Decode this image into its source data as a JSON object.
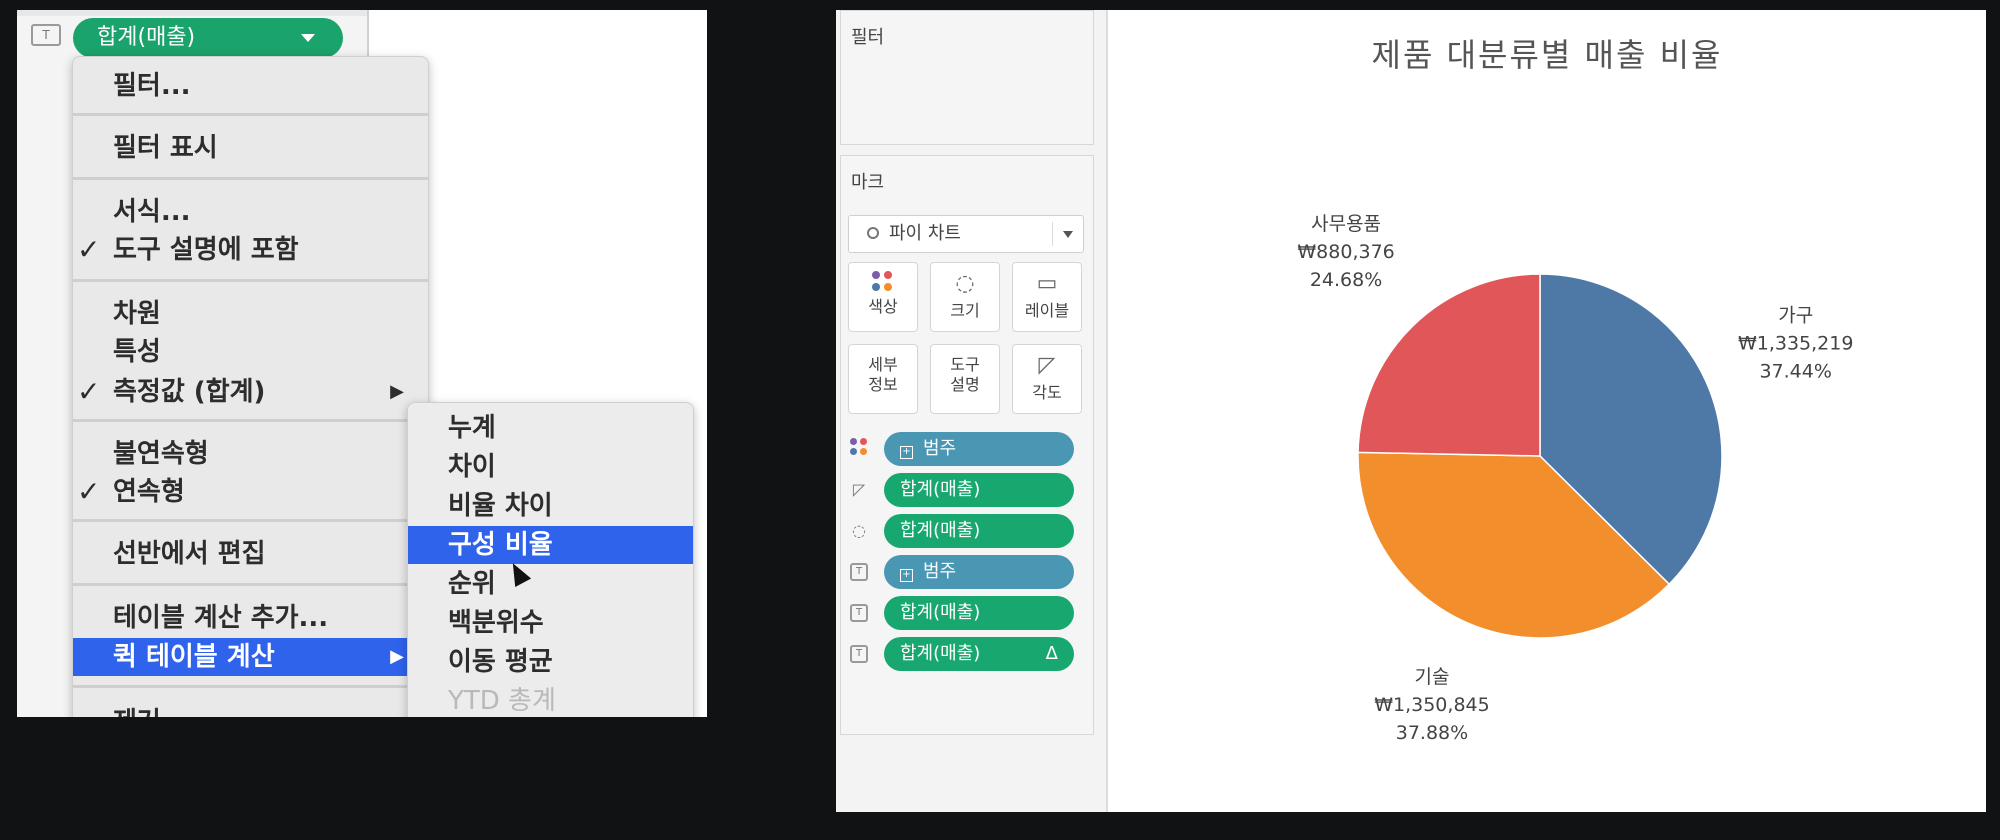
{
  "left": {
    "shelf_pill": "합계(매출)",
    "menu": {
      "items": [
        {
          "label": "필터...",
          "checked": false,
          "submenu": false
        },
        {
          "label": "필터 표시",
          "checked": false,
          "submenu": false
        },
        {
          "label": "서식...",
          "checked": false,
          "submenu": false
        },
        {
          "label": "도구 설명에 포함",
          "checked": true,
          "submenu": false
        },
        {
          "label": "차원",
          "checked": false,
          "submenu": false
        },
        {
          "label": "특성",
          "checked": false,
          "submenu": false
        },
        {
          "label": "측정값 (합계)",
          "checked": true,
          "submenu": true
        },
        {
          "label": "불연속형",
          "checked": false,
          "submenu": false
        },
        {
          "label": "연속형",
          "checked": true,
          "submenu": false
        },
        {
          "label": "선반에서 편집",
          "checked": false,
          "submenu": false
        },
        {
          "label": "테이블 계산 추가...",
          "checked": false,
          "submenu": false
        },
        {
          "label": "퀵 테이블 계산",
          "checked": false,
          "submenu": true,
          "highlighted": true
        },
        {
          "label": "제거",
          "checked": false,
          "submenu": false
        }
      ],
      "check_glyph": "✓",
      "arrow_glyph": "▶"
    },
    "submenu": {
      "items": [
        {
          "label": "누계"
        },
        {
          "label": "차이"
        },
        {
          "label": "비율 차이"
        },
        {
          "label": "구성 비율",
          "highlighted": true
        },
        {
          "label": "순위"
        },
        {
          "label": "백분위수"
        },
        {
          "label": "이동 평균"
        },
        {
          "label": "YTD 총계",
          "disabled": true
        }
      ]
    }
  },
  "right": {
    "filters_title": "필터",
    "marks_title": "마크",
    "mark_type": "파이 차트",
    "mark_buttons": [
      {
        "label": "색상",
        "icon": "color-dots-icon"
      },
      {
        "label": "크기",
        "icon": "size-icon"
      },
      {
        "label": "레이블",
        "icon": "label-icon"
      },
      {
        "label": "세부\n정보",
        "icon": "none"
      },
      {
        "label": "도구\n설명",
        "icon": "none"
      },
      {
        "label": "각도",
        "icon": "angle-icon"
      }
    ],
    "mark_pills": [
      {
        "icon": "color-dots-icon",
        "label": "범주",
        "kind": "dimension"
      },
      {
        "icon": "angle-icon",
        "label": "합계(매출)",
        "kind": "measure"
      },
      {
        "icon": "size-icon",
        "label": "합계(매출)",
        "kind": "measure"
      },
      {
        "icon": "label-icon",
        "label": "범주",
        "kind": "dimension"
      },
      {
        "icon": "label-icon",
        "label": "합계(매출)",
        "kind": "measure"
      },
      {
        "icon": "label-icon",
        "label": "합계(매출)",
        "kind": "measure",
        "delta": "Δ"
      }
    ]
  },
  "chart_data": {
    "type": "pie",
    "title": "제품 대분류별 매출 비율",
    "slices": [
      {
        "name": "가구",
        "value": 1335219,
        "value_label": "₩1,335,219",
        "percent_label": "37.44%",
        "color": "#4e79a7"
      },
      {
        "name": "기술",
        "value": 1350845,
        "value_label": "₩1,350,845",
        "percent_label": "37.88%",
        "color": "#f28e2b"
      },
      {
        "name": "사무용품",
        "value": 880376,
        "value_label": "₩880,376",
        "percent_label": "24.68%",
        "color": "#e15759"
      }
    ],
    "start_angle_deg": 0,
    "direction": "clockwise"
  }
}
